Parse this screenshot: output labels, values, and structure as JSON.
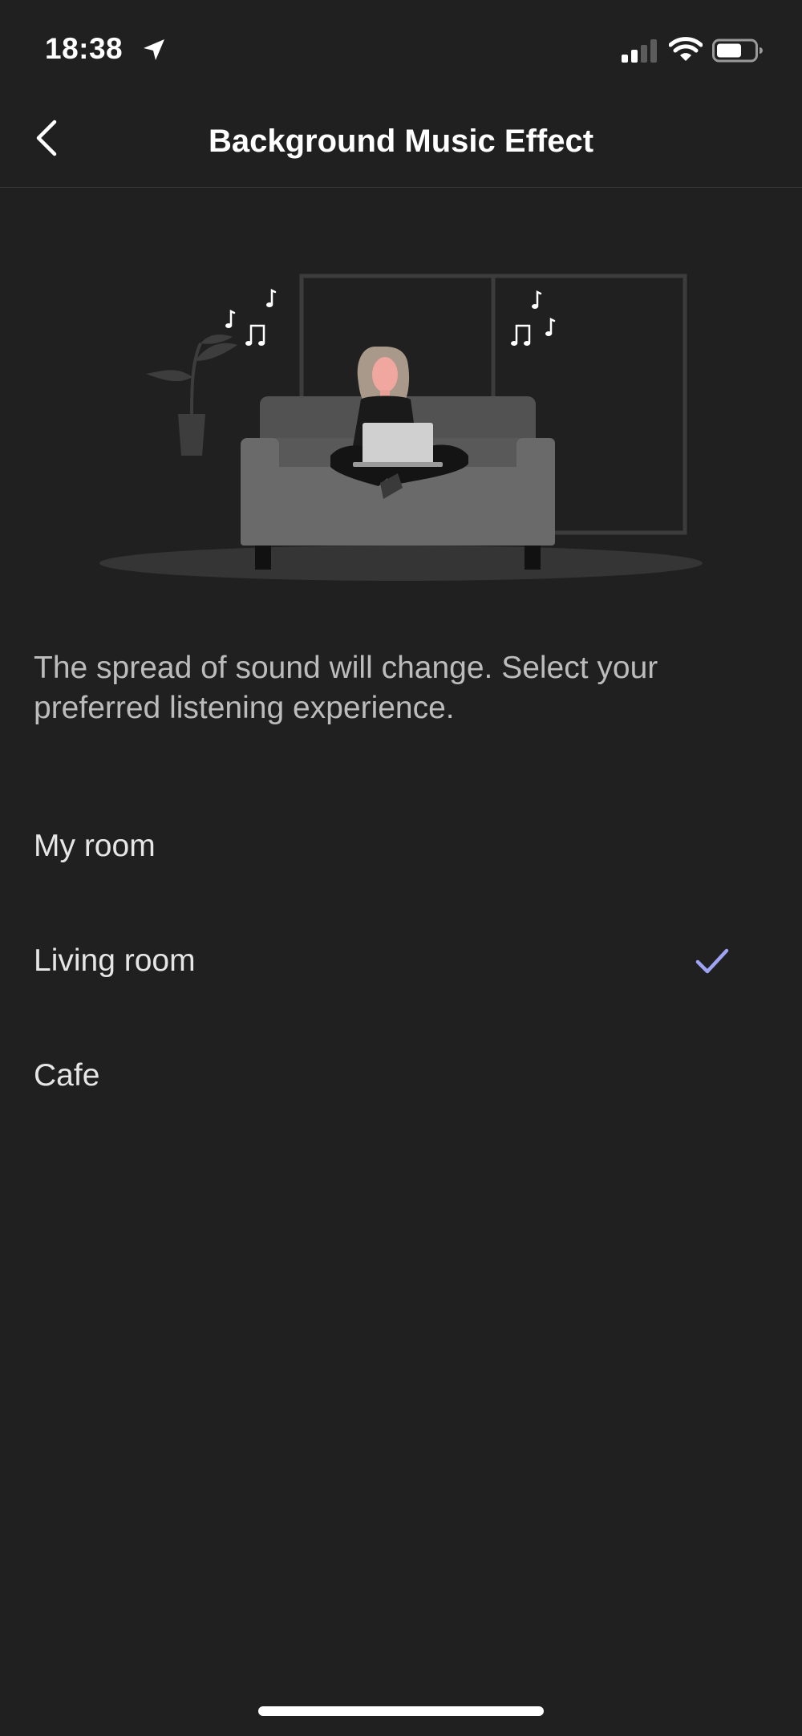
{
  "status_bar": {
    "time": "18:38",
    "icons": [
      "location-arrow-icon",
      "cellular-signal-icon",
      "wifi-icon",
      "battery-icon"
    ]
  },
  "nav": {
    "title": "Background Music Effect",
    "back_icon": "chevron-left-icon"
  },
  "illustration": {
    "icon": "person-on-sofa-with-laptop-illustration"
  },
  "description": "The spread of sound will change. Select your preferred listening experience.",
  "options": [
    {
      "label": "My room",
      "selected": false
    },
    {
      "label": "Living room",
      "selected": true
    },
    {
      "label": "Cafe",
      "selected": false
    }
  ],
  "colors": {
    "background": "#202020",
    "text": "#ffffff",
    "secondary_text": "#bcbcbc",
    "check_accent": "#9ea3f3"
  }
}
